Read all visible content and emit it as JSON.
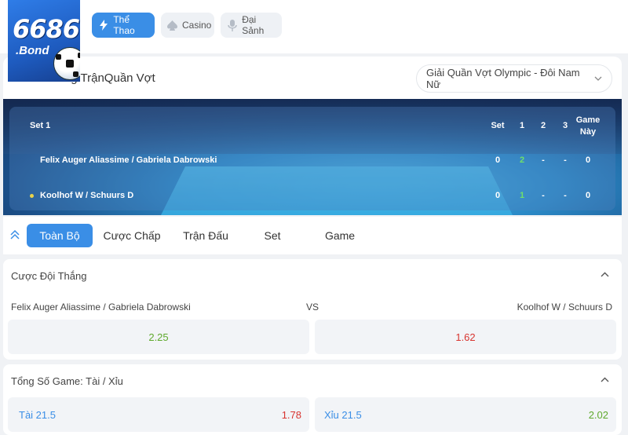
{
  "logo": {
    "line1": "6686",
    "line2": ".Bond"
  },
  "nav": [
    {
      "label": "Thể Thao",
      "icon": "lightning-icon",
      "active": true
    },
    {
      "label": "Casino",
      "icon": "spade-icon",
      "active": false
    },
    {
      "label": "Đại Sảnh",
      "icon": "microphone-icon",
      "active": false
    }
  ],
  "header": {
    "title": "Trong TrậnQuần Vợt",
    "league": "Giải Quần Vợt Olympic - Đôi Nam Nữ"
  },
  "scoreboard": {
    "set_label": "Set 1",
    "columns": [
      "Set",
      "1",
      "2",
      "3",
      "Game Này"
    ],
    "rows": [
      {
        "team": "Felix Auger Aliassime / Gabriela Dabrowski",
        "set": "0",
        "s1": "2",
        "s2": "-",
        "s3": "-",
        "game": "0",
        "serving": false
      },
      {
        "team": "Koolhof W / Schuurs D",
        "set": "0",
        "s1": "1",
        "s2": "-",
        "s3": "-",
        "game": "0",
        "serving": true
      }
    ]
  },
  "tabs": [
    "Toàn Bộ",
    "Cược Chấp",
    "Trận Đấu",
    "Set",
    "Game"
  ],
  "winner_market": {
    "title": "Cược Đội Thắng",
    "home": "Felix Auger Aliassime / Gabriela Dabrowski",
    "vs": "VS",
    "away": "Koolhof W / Schuurs D",
    "home_odds": "2.25",
    "away_odds": "1.62"
  },
  "total_market": {
    "title": "Tổng Số Game: Tài / Xỉu",
    "over_label": "Tài 21.5",
    "over_odds": "1.78",
    "under_label": "Xỉu 21.5",
    "under_odds": "2.02"
  },
  "colors": {
    "accent": "#3a8ee6",
    "odds_up": "#5fa92d",
    "odds_down": "#d8342f"
  }
}
